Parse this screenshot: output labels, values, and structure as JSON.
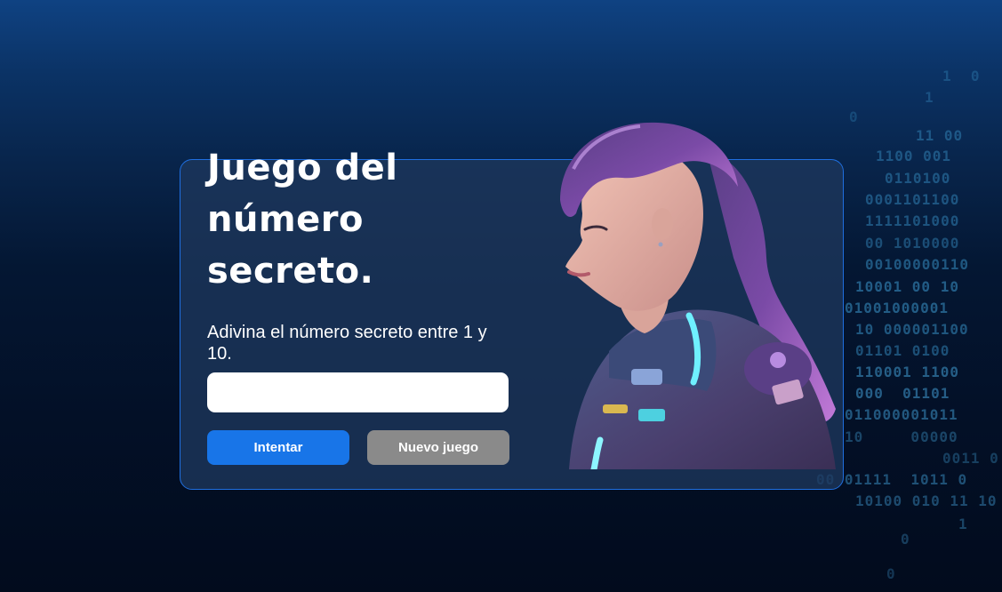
{
  "page": {
    "title": "Juego del número secreto.",
    "subtitle": "Adivina el número secreto entre 1 y 10.",
    "input_value": "",
    "buttons": {
      "try": "Intentar",
      "new_game": "Nuevo juego"
    }
  },
  "background_binary": [
    "1  0",
    "1",
    "0",
    "11 00",
    "1100 001",
    "0110100",
    "0001101100",
    "1111101000",
    "00 1010000",
    "00100000110",
    "10001 00 10",
    "01001000001",
    "10 000001100",
    "01101 0100",
    "110001 1100",
    "000  01101",
    "011000001011",
    "10     00000",
    "0011 0",
    "00 01111  1011 0",
    "10100 010 11 10",
    "1",
    "0",
    "0"
  ],
  "colors": {
    "accent": "#1875e8",
    "secondary_button": "#8a8a8a",
    "card_border": "#1f6fe0",
    "background_top": "#0f4282",
    "background_bottom": "#020b1d"
  },
  "icons": {
    "illustration": "astronaut-girl-illustration"
  }
}
